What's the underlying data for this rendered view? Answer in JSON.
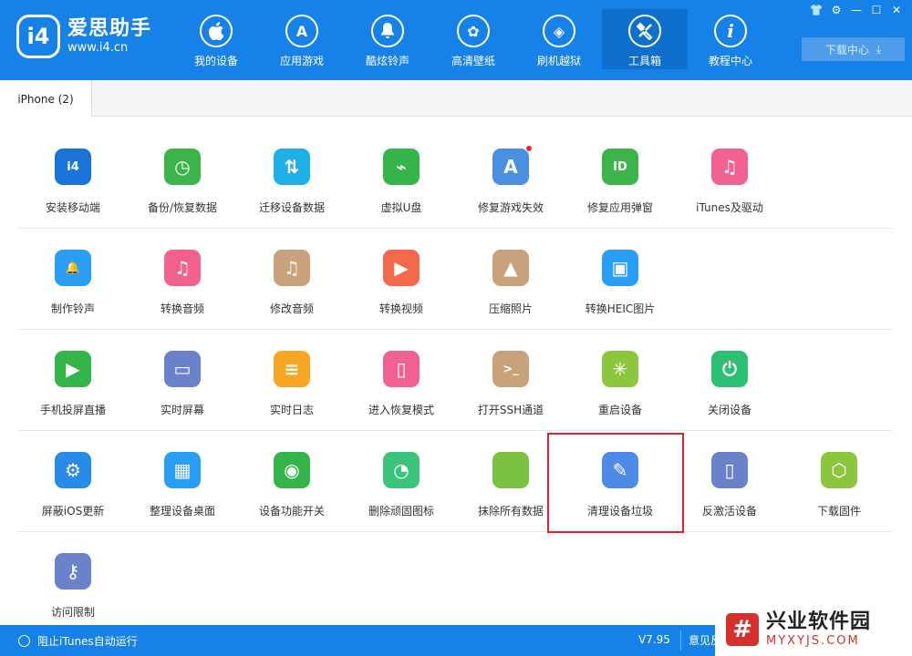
{
  "app": {
    "logo_badge": "i4",
    "name": "爱思助手",
    "url": "www.i4.cn"
  },
  "nav": [
    {
      "label": "我的设备",
      "icon": "apple-icon",
      "glyph": ""
    },
    {
      "label": "应用游戏",
      "icon": "app-store-icon",
      "glyph": "A"
    },
    {
      "label": "酷炫铃声",
      "icon": "bell-icon",
      "glyph": "🔔"
    },
    {
      "label": "高清壁纸",
      "icon": "flower-icon",
      "glyph": "✿"
    },
    {
      "label": "刷机越狱",
      "icon": "dropbox-icon",
      "glyph": "◈"
    },
    {
      "label": "工具箱",
      "icon": "tools-icon",
      "glyph": "✕"
    },
    {
      "label": "教程中心",
      "icon": "info-icon",
      "glyph": "i"
    }
  ],
  "window_controls": [
    "shirt-icon",
    "gear-icon",
    "minimize-icon",
    "maximize-icon",
    "close-icon"
  ],
  "download_center": {
    "label": "下载中心",
    "icon": "download-icon"
  },
  "tab": {
    "label": "iPhone (2)"
  },
  "tools": {
    "row1": [
      {
        "label": "安装移动端",
        "color": "#1a73d9",
        "icon": "i4-logo-icon",
        "glyph": "i4"
      },
      {
        "label": "备份/恢复数据",
        "color": "#3cb44a",
        "icon": "clock-restore-icon",
        "glyph": "◷"
      },
      {
        "label": "迁移设备数据",
        "color": "#1fb0e8",
        "icon": "transfer-icon",
        "glyph": "⇅"
      },
      {
        "label": "虚拟U盘",
        "color": "#35b44a",
        "icon": "usb-icon",
        "glyph": "⌁"
      },
      {
        "label": "修复游戏失效",
        "color": "#4a90e2",
        "icon": "app-store-repair-icon",
        "glyph": "A",
        "dot": true
      },
      {
        "label": "修复应用弹窗",
        "color": "#3cb44a",
        "icon": "apple-id-icon",
        "glyph": "ID"
      },
      {
        "label": "iTunes及驱动",
        "color": "#f06292",
        "icon": "itunes-icon",
        "glyph": "♫"
      }
    ],
    "row2": [
      {
        "label": "制作铃声",
        "color": "#2a9df4",
        "icon": "bell-plus-icon",
        "glyph": "🔔"
      },
      {
        "label": "转换音频",
        "color": "#f0628d",
        "icon": "music-icon",
        "glyph": "♫"
      },
      {
        "label": "修改音频",
        "color": "#c9a27c",
        "icon": "music-edit-icon",
        "glyph": "♫"
      },
      {
        "label": "转换视频",
        "color": "#f26a4b",
        "icon": "play-icon",
        "glyph": "▶"
      },
      {
        "label": "压缩照片",
        "color": "#c9a27c",
        "icon": "photo-icon",
        "glyph": "▲"
      },
      {
        "label": "转换HEIC图片",
        "color": "#2a9df4",
        "icon": "heic-icon",
        "glyph": "▣"
      }
    ],
    "row3": [
      {
        "label": "手机投屏直播",
        "color": "#35b44a",
        "icon": "screen-cast-icon",
        "glyph": "▶"
      },
      {
        "label": "实时屏幕",
        "color": "#6a82c9",
        "icon": "monitor-icon",
        "glyph": "▭"
      },
      {
        "label": "实时日志",
        "color": "#f5a623",
        "icon": "log-icon",
        "glyph": "≡"
      },
      {
        "label": "进入恢复模式",
        "color": "#f06292",
        "icon": "recovery-icon",
        "glyph": "▯"
      },
      {
        "label": "打开SSH通道",
        "color": "#c9a27c",
        "icon": "terminal-icon",
        "glyph": ">_"
      },
      {
        "label": "重启设备",
        "color": "#8cc63f",
        "icon": "restart-icon",
        "glyph": "✳"
      },
      {
        "label": "关闭设备",
        "color": "#2dbf72",
        "icon": "power-icon",
        "glyph": "⏻"
      }
    ],
    "row4": [
      {
        "label": "屏蔽iOS更新",
        "color": "#2a8ae8",
        "icon": "block-update-icon",
        "glyph": "⚙"
      },
      {
        "label": "整理设备桌面",
        "color": "#2a9df4",
        "icon": "grid-icon",
        "glyph": "▦"
      },
      {
        "label": "设备功能开关",
        "color": "#35b44a",
        "icon": "toggle-icon",
        "glyph": "◉"
      },
      {
        "label": "删除顽固图标",
        "color": "#3cc47c",
        "icon": "pie-icon",
        "glyph": "◔"
      },
      {
        "label": "抹除所有数据",
        "color": "#7cc242",
        "icon": "erase-icon",
        "glyph": ""
      },
      {
        "label": "清理设备垃圾",
        "color": "#4e8be8",
        "icon": "broom-icon",
        "glyph": "✎"
      },
      {
        "label": "反激活设备",
        "color": "#6a82c9",
        "icon": "deactivate-icon",
        "glyph": "▯"
      },
      {
        "label": "下载固件",
        "color": "#8cc63f",
        "icon": "cube-icon",
        "glyph": "⬡"
      }
    ],
    "row5": [
      {
        "label": "访问限制",
        "color": "#6a82c9",
        "icon": "key-icon",
        "glyph": "⚷"
      }
    ]
  },
  "footer": {
    "itunes_toggle": "阻止iTunes自动运行",
    "version": "V7.95",
    "feedback": "意见反"
  },
  "watermark": {
    "mark": "#",
    "title": "兴业软件园",
    "url": "MYXYJS.COM"
  }
}
